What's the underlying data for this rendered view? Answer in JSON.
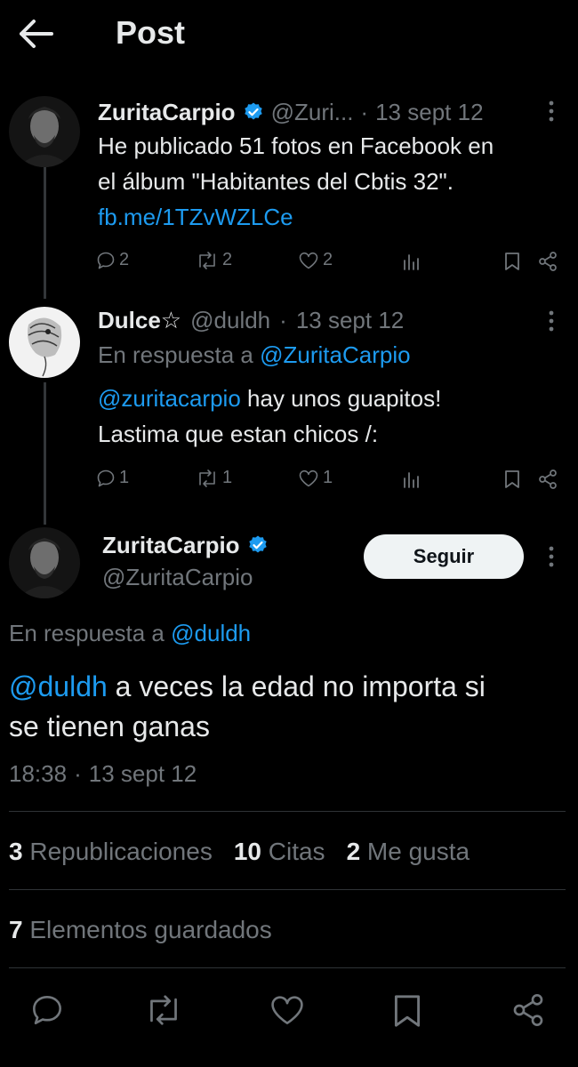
{
  "header": {
    "title": "Post"
  },
  "tweets": [
    {
      "name": "ZuritaCarpio",
      "handle": "@Zuri...",
      "dot": "·",
      "date": "13 sept 12",
      "text_line1": "He publicado 51 fotos en Facebook en",
      "text_line2": "el álbum \"Habitantes del Cbtis 32\".",
      "link": "fb.me/1TZvWZLCe",
      "replies": "2",
      "retweets": "2",
      "likes": "2"
    },
    {
      "name": "Dulce☆",
      "handle": "@duldh",
      "dot": "·",
      "date": "13 sept 12",
      "reply_prefix": "En respuesta a",
      "reply_to": "@ZuritaCarpio",
      "mention": "@zuritacarpio",
      "text_line1_rest": " hay unos guapitos!",
      "text_line2": "Lastima que estan chicos /:",
      "replies": "1",
      "retweets": "1",
      "likes": "1"
    }
  ],
  "main_post": {
    "name": "ZuritaCarpio",
    "handle": "@ZuritaCarpio",
    "follow_label": "Seguir",
    "reply_prefix": "En respuesta a",
    "reply_to": "@duldh",
    "mention": "@duldh",
    "text_line1_rest": " a veces la edad no importa si",
    "text_line2": "se tienen ganas",
    "time": "18:38",
    "dot": "·",
    "date": "13 sept 12",
    "stats": {
      "republications_count": "3",
      "republications_label": "Republicaciones",
      "quotes_count": "10",
      "quotes_label": "Citas",
      "likes_count": "2",
      "likes_label": "Me gusta",
      "bookmarks_count": "7",
      "bookmarks_label": "Elementos guardados"
    }
  },
  "colors": {
    "background": "#000000",
    "text": "#e7e9ea",
    "muted": "#71767b",
    "link": "#1d9bf0",
    "verified": "#1d9bf0",
    "divider": "#2f3336"
  },
  "icons": [
    "back-arrow-icon",
    "verified-badge-icon",
    "more-icon",
    "reply-icon",
    "retweet-icon",
    "like-icon",
    "views-icon",
    "bookmark-icon",
    "share-icon"
  ]
}
